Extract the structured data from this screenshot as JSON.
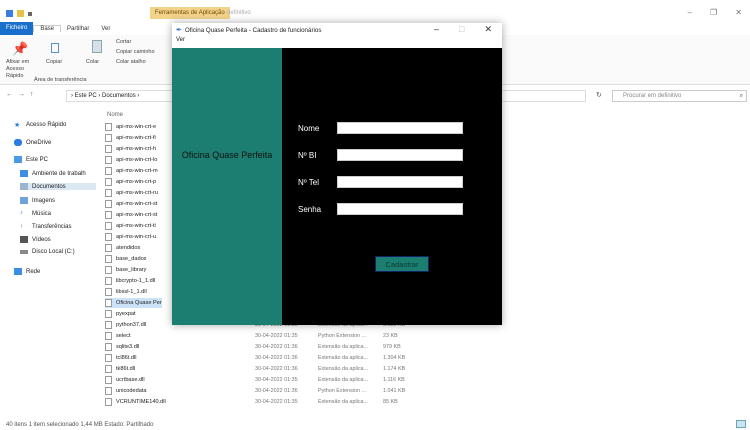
{
  "explorer": {
    "context_tab": "Ferramentas de Aplicação",
    "window_title": "definitivo",
    "tabs": [
      "Ficheiro",
      "Base",
      "Partilhar",
      "Ver"
    ],
    "ribbon": {
      "pin_label": "Afixar em Acesso Rápido",
      "copy_label": "Copiar",
      "paste_label": "Colar",
      "cut_label": "Cortar",
      "copy_path_label": "Copiar caminho",
      "paste_shortcut_label": "Colar atalho",
      "group_label": "Área de transferência"
    },
    "breadcrumb": "› Este PC › Documentos ›",
    "search_placeholder": "Procurar em definitivo",
    "column_name": "Nome",
    "sidebar": [
      "Acesso Rápido",
      "OneDrive",
      "Este PC",
      "Ambiente de trabalh",
      "Documentos",
      "Imagens",
      "Música",
      "Transferências",
      "Vídeos",
      "Disco Local (C:)",
      "Rede"
    ],
    "files": [
      "api-ms-win-crt-e",
      "api-ms-win-crt-fi",
      "api-ms-win-crt-h",
      "api-ms-win-crt-lo",
      "api-ms-win-crt-m",
      "api-ms-win-crt-p",
      "api-ms-win-crt-ru",
      "api-ms-win-crt-st",
      "api-ms-win-crt-st",
      "api-ms-win-crt-ti",
      "api-ms-win-crt-u",
      "atendidos",
      "base_dados",
      "base_library",
      "libcrypto-1_1.dll",
      "libssl-1_1.dll",
      "Oficina Quase Per",
      "pyexpat",
      "python37.dll",
      "select",
      "sqlite3.dll",
      "tcl86t.dll",
      "tk86t.dll",
      "ucrtbase.dll",
      "unicodedata",
      "VCRUNTIME140.dll"
    ],
    "details": [
      {
        "date": "30-04-2022 01:35",
        "type": "Extensão da aplica...",
        "size": "3.522 KB"
      },
      {
        "date": "30-04-2022 01:35",
        "type": "Python Extension ...",
        "size": "23 KB"
      },
      {
        "date": "30-04-2022 01:36",
        "type": "Extensão da aplica...",
        "size": "979 KB"
      },
      {
        "date": "30-04-2022 01:36",
        "type": "Extensão da aplica...",
        "size": "1.304 KB"
      },
      {
        "date": "30-04-2022 01:36",
        "type": "Extensão da aplica...",
        "size": "1.174 KB"
      },
      {
        "date": "30-04-2022 01:35",
        "type": "Extensão da aplica...",
        "size": "1.116 KB"
      },
      {
        "date": "30-04-2022 01:36",
        "type": "Python Extension ...",
        "size": "1.041 KB"
      },
      {
        "date": "30-04-2022 01:35",
        "type": "Extensão da aplica...",
        "size": "85 KB"
      }
    ],
    "status": "40 itens   1 item selecionado 1,44 MB   Estado: Partilhado"
  },
  "dialog": {
    "title": "Oficina Quase Perfeita - Cadastro de funcionários",
    "menu": "Ver",
    "brand": "Oficina Quase Perfeita",
    "fields": [
      {
        "label": "Nome",
        "value": ""
      },
      {
        "label": "Nº BI",
        "value": ""
      },
      {
        "label": "Nº Tel",
        "value": ""
      },
      {
        "label": "Senha",
        "value": ""
      }
    ],
    "submit_label": "Cadastrar",
    "accent": "#1b7e70"
  }
}
